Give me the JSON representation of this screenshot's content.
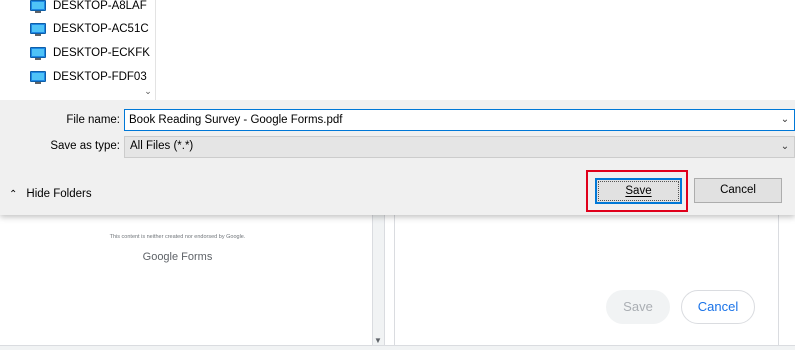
{
  "dialog": {
    "tree_items": [
      {
        "label": "DESKTOP-A8LAF",
        "icon": "computer-icon"
      },
      {
        "label": "DESKTOP-AC51C",
        "icon": "computer-icon"
      },
      {
        "label": "DESKTOP-ECKFK",
        "icon": "computer-icon"
      },
      {
        "label": "DESKTOP-FDF03",
        "icon": "computer-icon"
      }
    ],
    "filename_label": "File name:",
    "filename_label_access_key": "n",
    "filename_value": "Book Reading Survey - Google Forms.pdf",
    "savetype_label": "Save as type:",
    "savetype_value": "All Files (*.*)",
    "hide_folders_label": "Hide Folders",
    "save_label": "Save",
    "cancel_label": "Cancel"
  },
  "background": {
    "page_note": "This content is neither created nor endorsed by Google.",
    "page_logo": "Google Forms",
    "save_label": "Save",
    "cancel_label": "Cancel"
  },
  "colors": {
    "highlight": "#e0001b",
    "focus_blue": "#0078d7",
    "chrome_blue": "#1a73e8"
  }
}
